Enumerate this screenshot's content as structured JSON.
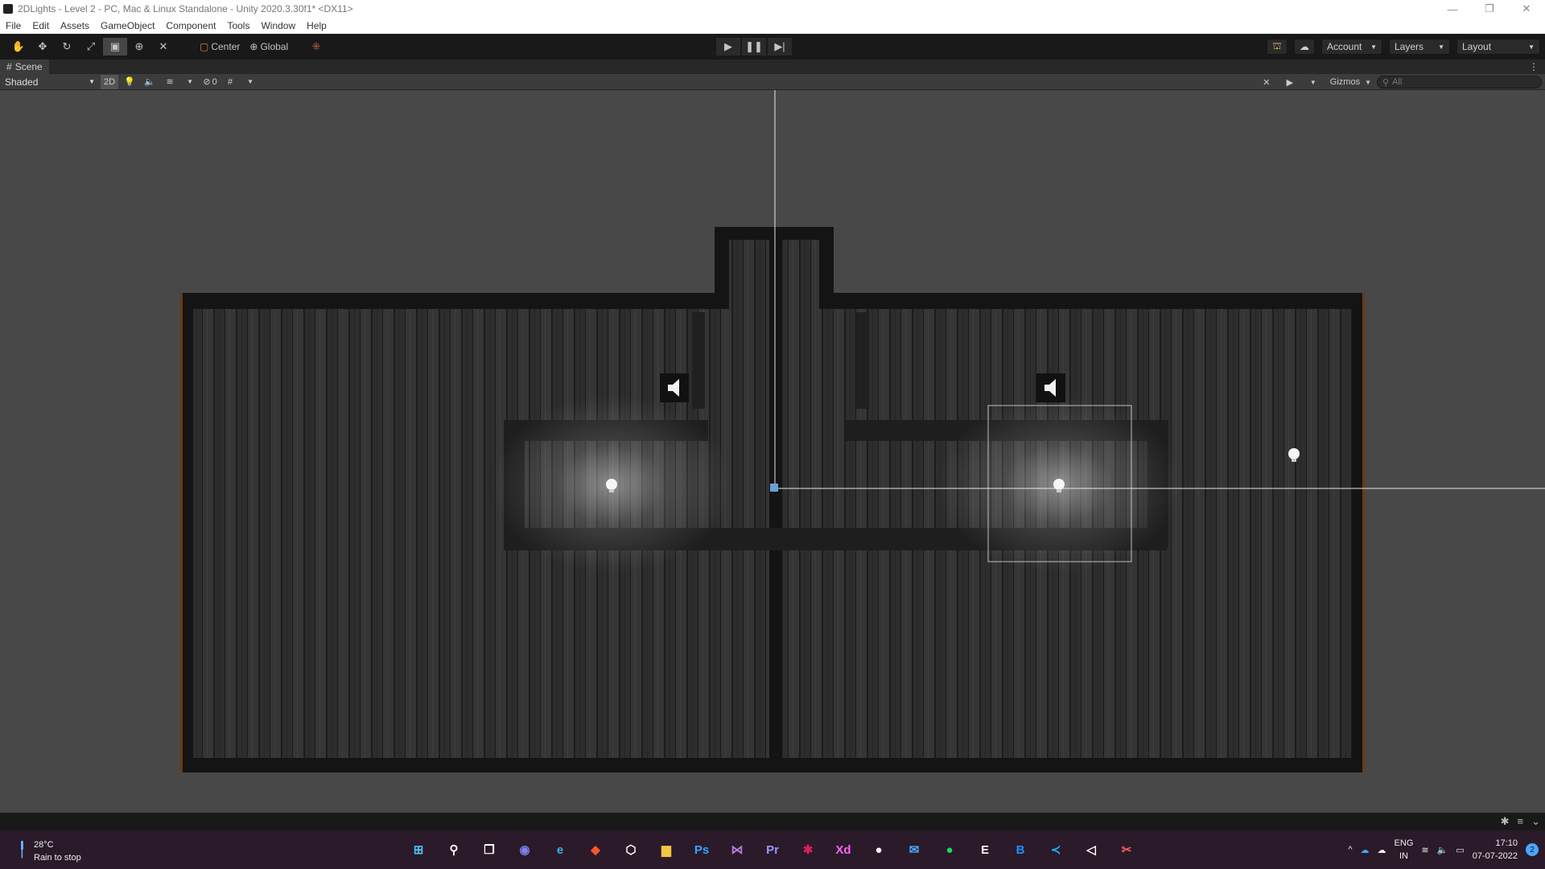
{
  "window": {
    "title": "2DLights - Level 2 - PC, Mac & Linux Standalone - Unity 2020.3.30f1* <DX11>",
    "controls": [
      "—",
      "❐",
      "✕"
    ]
  },
  "menu": [
    "File",
    "Edit",
    "Assets",
    "GameObject",
    "Component",
    "Tools",
    "Window",
    "Help"
  ],
  "toolbar": {
    "pivot_center": "Center",
    "pivot_global": "Global",
    "account_label": "Account",
    "layers_label": "Layers",
    "layout_label": "Layout"
  },
  "scene_tab": {
    "label": "Scene"
  },
  "scene_toolbar": {
    "shading_mode": "Shaded",
    "mode_2d": "2D",
    "hidden_count": "0",
    "gizmos_label": "Gizmos",
    "search_placeholder": "All"
  },
  "taskbar": {
    "temperature": "28°C",
    "weather_text": "Rain to stop",
    "language": "ENG",
    "region": "IN",
    "time": "17:10",
    "date": "07-07-2022",
    "notification_count": "2",
    "apps": [
      {
        "name": "start",
        "glyph": "⊞",
        "color": "#4cc2ff"
      },
      {
        "name": "search",
        "glyph": "⚲",
        "color": "#ffffff"
      },
      {
        "name": "task-view",
        "glyph": "❐",
        "color": "#ffffff"
      },
      {
        "name": "teams-chat",
        "glyph": "◉",
        "color": "#7b83eb"
      },
      {
        "name": "edge",
        "glyph": "e",
        "color": "#33b3e8"
      },
      {
        "name": "brave",
        "glyph": "◆",
        "color": "#fb542b"
      },
      {
        "name": "unity-hub",
        "glyph": "⬡",
        "color": "#ffffff"
      },
      {
        "name": "file-explorer",
        "glyph": "▆",
        "color": "#f5c542"
      },
      {
        "name": "photoshop",
        "glyph": "Ps",
        "color": "#31a8ff"
      },
      {
        "name": "visual-studio",
        "glyph": "⋈",
        "color": "#b180d7"
      },
      {
        "name": "premiere",
        "glyph": "Pr",
        "color": "#9999ff"
      },
      {
        "name": "slack",
        "glyph": "✱",
        "color": "#e01e5a"
      },
      {
        "name": "adobe-xd",
        "glyph": "Xd",
        "color": "#ff61f6"
      },
      {
        "name": "github",
        "glyph": "●",
        "color": "#ffffff"
      },
      {
        "name": "mail",
        "glyph": "✉",
        "color": "#4aa6ff"
      },
      {
        "name": "spotify",
        "glyph": "●",
        "color": "#1ed760"
      },
      {
        "name": "epic-games",
        "glyph": "E",
        "color": "#ffffff"
      },
      {
        "name": "blue-app",
        "glyph": "B",
        "color": "#1e90ff"
      },
      {
        "name": "vs-code",
        "glyph": "≺",
        "color": "#23a9f2"
      },
      {
        "name": "unity",
        "glyph": "◁",
        "color": "#ffffff"
      },
      {
        "name": "snipping-tool",
        "glyph": "✂",
        "color": "#ff5c5c"
      }
    ]
  }
}
